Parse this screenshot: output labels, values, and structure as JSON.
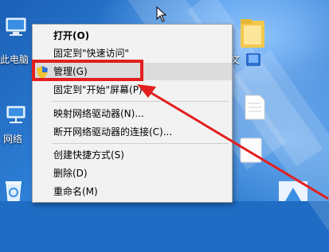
{
  "desktop": {
    "icons": [
      {
        "name": "this-pc",
        "label": "此电脑"
      },
      {
        "name": "network",
        "label": "网络"
      }
    ],
    "partial_label_right": "文"
  },
  "context_menu": {
    "items": [
      {
        "label": "打开(O)"
      },
      {
        "label": "固定到\"快速访问\""
      },
      {
        "label": "管理(G)"
      },
      {
        "label": "固定到\"开始\"屏幕(P)"
      },
      {
        "label": "映射网络驱动器(N)..."
      },
      {
        "label": "断开网络驱动器的连接(C)..."
      },
      {
        "label": "创建快捷方式(S)"
      },
      {
        "label": "删除(D)"
      },
      {
        "label": "重命名(M)"
      }
    ]
  },
  "annotation": {
    "color": "#e31f1f"
  }
}
